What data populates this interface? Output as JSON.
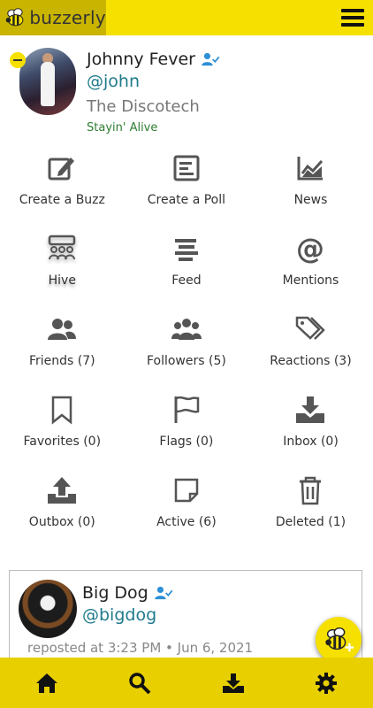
{
  "app": {
    "brand": "buzzerly",
    "accent_color": "#f5e000",
    "bottombar_color": "#e8cf00"
  },
  "header": {
    "menu_icon": "hamburger-icon"
  },
  "profile": {
    "name": "Johnny Fever",
    "handle": "@john",
    "venue": "The Discotech",
    "song": "Stayin' Alive",
    "verified_icon": "user-check-icon"
  },
  "menu": [
    {
      "label": "Create a Buzz",
      "icon": "edit-icon"
    },
    {
      "label": "Create a Poll",
      "icon": "poll-icon"
    },
    {
      "label": "News",
      "icon": "chart-icon"
    },
    {
      "label": "Hive",
      "icon": "hive-icon"
    },
    {
      "label": "Feed",
      "icon": "feed-icon"
    },
    {
      "label": "Mentions",
      "icon": "at-icon"
    },
    {
      "label": "Friends (7)",
      "icon": "friends-icon"
    },
    {
      "label": "Followers (5)",
      "icon": "followers-icon"
    },
    {
      "label": "Reactions (3)",
      "icon": "tags-icon"
    },
    {
      "label": "Favorites (0)",
      "icon": "bookmark-icon"
    },
    {
      "label": "Flags (0)",
      "icon": "flag-icon"
    },
    {
      "label": "Inbox (0)",
      "icon": "inbox-icon"
    },
    {
      "label": "Outbox (0)",
      "icon": "outbox-icon"
    },
    {
      "label": "Active (6)",
      "icon": "note-icon"
    },
    {
      "label": "Deleted (1)",
      "icon": "trash-icon"
    }
  ],
  "post": {
    "name": "Big Dog",
    "handle": "@bigdog",
    "meta": "reposted at 3:23 PM • Jun 6, 2021"
  },
  "bottom_nav": [
    {
      "name": "home",
      "icon": "home-icon"
    },
    {
      "name": "search",
      "icon": "search-icon"
    },
    {
      "name": "inbox",
      "icon": "download-icon"
    },
    {
      "name": "settings",
      "icon": "gear-icon"
    }
  ]
}
